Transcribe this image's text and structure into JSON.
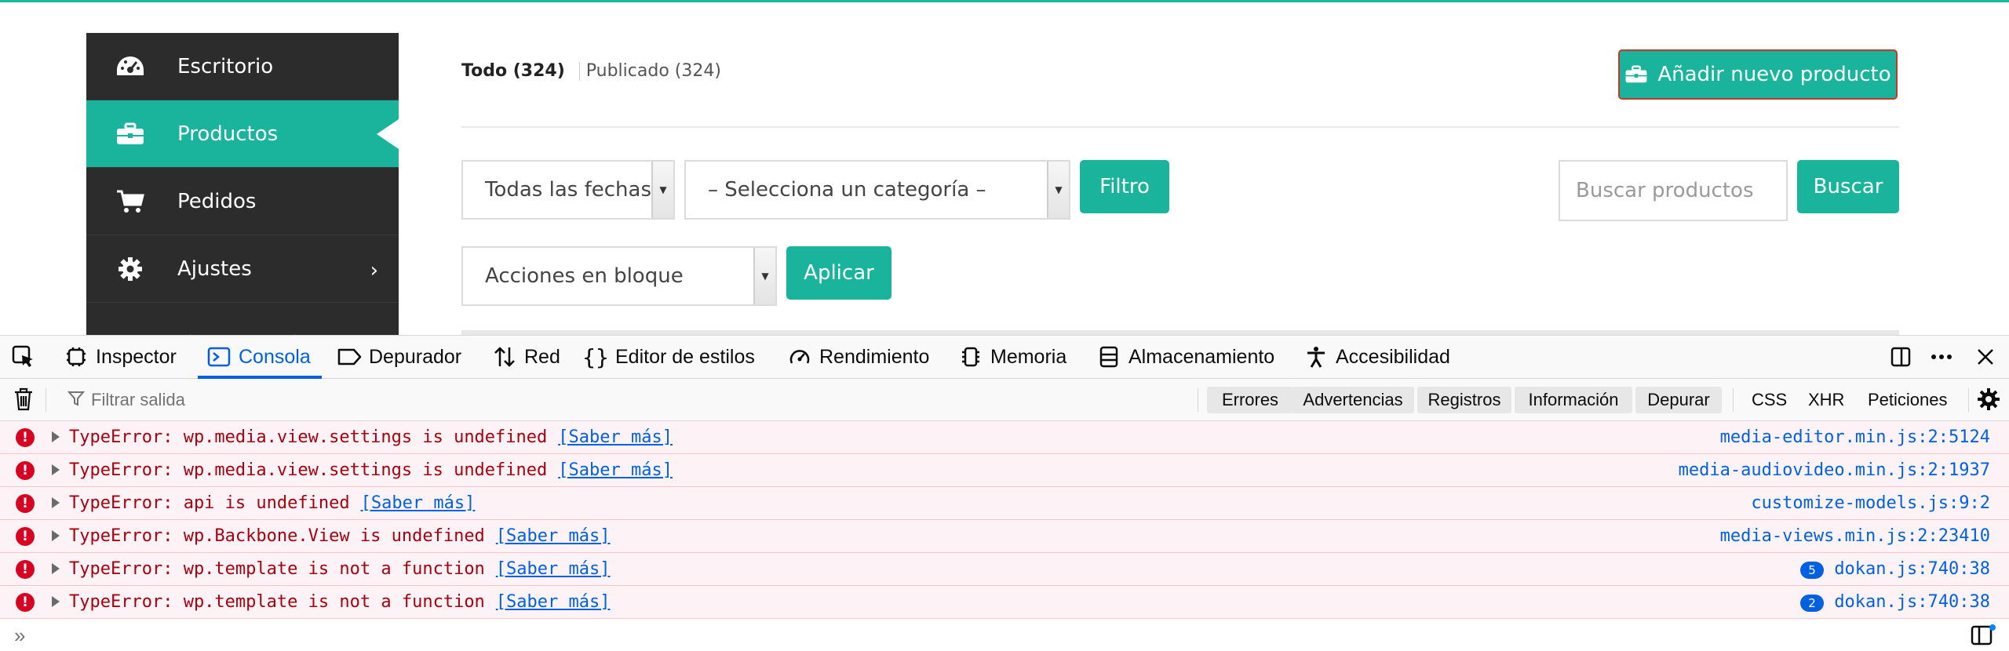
{
  "sidebar": {
    "items": [
      {
        "label": "Escritorio",
        "icon": "dashboard-icon"
      },
      {
        "label": "Productos",
        "icon": "briefcase-icon",
        "active": true
      },
      {
        "label": "Pedidos",
        "icon": "cart-icon"
      },
      {
        "label": "Ajustes",
        "icon": "gear-icon"
      }
    ],
    "settings_chevron": "›"
  },
  "main": {
    "status": {
      "all": "Todo (324)",
      "published": "Publicado (324)"
    },
    "add_product_label": "Añadir nuevo producto",
    "filters": {
      "dates_value": "Todas las fechas",
      "category_value": "– Selecciona un categoría –",
      "filter_label": "Filtro",
      "search_placeholder": "Buscar productos",
      "search_label": "Buscar",
      "bulk_value": "Acciones en bloque",
      "apply_label": "Aplicar"
    }
  },
  "devtools": {
    "tabs": [
      {
        "label": "Inspector",
        "icon": "inspector-icon"
      },
      {
        "label": "Consola",
        "icon": "console-icon",
        "active": true
      },
      {
        "label": "Depurador",
        "icon": "debugger-icon"
      },
      {
        "label": "Red",
        "icon": "network-icon"
      },
      {
        "label": "Editor de estilos",
        "icon": "style-editor-icon"
      },
      {
        "label": "Rendimiento",
        "icon": "performance-icon"
      },
      {
        "label": "Memoria",
        "icon": "memory-icon"
      },
      {
        "label": "Almacenamiento",
        "icon": "storage-icon"
      },
      {
        "label": "Accesibilidad",
        "icon": "accessibility-icon"
      }
    ],
    "toolbar": {
      "filter_placeholder": "Filtrar salida",
      "levels": [
        "Errores",
        "Advertencias",
        "Registros",
        "Información",
        "Depurar"
      ],
      "types": [
        "CSS",
        "XHR",
        "Peticiones"
      ]
    },
    "messages": [
      {
        "text": "TypeError: wp.media.view.settings is undefined",
        "link": "[Saber más]",
        "source": "media-editor.min.js:2:5124"
      },
      {
        "text": "TypeError: wp.media.view.settings is undefined",
        "link": "[Saber más]",
        "source": "media-audiovideo.min.js:2:1937"
      },
      {
        "text": "TypeError: api is undefined",
        "link": "[Saber más]",
        "source": "customize-models.js:9:2"
      },
      {
        "text": "TypeError: wp.Backbone.View is undefined",
        "link": "[Saber más]",
        "source": "media-views.min.js:2:23410"
      },
      {
        "text": "TypeError: wp.template is not a function",
        "link": "[Saber más]",
        "source": "dokan.js:740:38",
        "count": "5"
      },
      {
        "text": "TypeError: wp.template is not a function",
        "link": "[Saber más]",
        "source": "dokan.js:740:38",
        "count": "2"
      }
    ],
    "prompt_symbol": "»"
  },
  "colors": {
    "accent": "#1ab39b",
    "sidebar_bg": "#2c2c2c",
    "devtools_active": "#0060df",
    "error_text": "#a4000f",
    "error_bg": "#fdf2f5"
  }
}
